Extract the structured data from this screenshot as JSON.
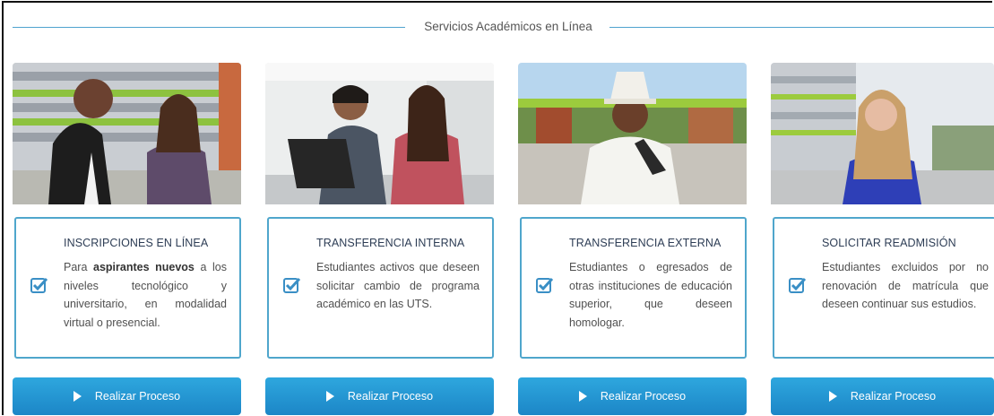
{
  "section": {
    "title": "Servicios Académicos en Línea"
  },
  "colors": {
    "accent": "#1c86c7",
    "border": "#4fa6cc",
    "heading": "#2d3d55"
  },
  "cards": [
    {
      "heading": "INSCRIPCIONES EN LÍNEA",
      "desc_pre": "Para ",
      "desc_bold": "aspirantes nuevos",
      "desc_post": " a los niveles tecnológico y universitario, en modalidad virtual o presencial.",
      "button": "Realizar Proceso",
      "icon": "checkbox-checked-icon"
    },
    {
      "heading": "TRANSFERENCIA INTERNA",
      "desc_pre": "Estudiantes activos que deseen solicitar cambio de programa académico en las UTS.",
      "desc_bold": "",
      "desc_post": "",
      "button": "Realizar Proceso",
      "icon": "checkbox-checked-icon"
    },
    {
      "heading": "TRANSFERENCIA EXTERNA",
      "desc_pre": "Estudiantes o egresados de otras instituciones de educación superior, que deseen homologar.",
      "desc_bold": "",
      "desc_post": "",
      "button": "Realizar Proceso",
      "icon": "checkbox-checked-icon"
    },
    {
      "heading": "SOLICITAR READMISIÓN",
      "desc_pre": "Estudiantes excluidos por no renovación de matrícula que deseen continuar sus estudios.",
      "desc_bold": "",
      "desc_post": "",
      "button": "Realizar Proceso",
      "icon": "checkbox-checked-icon"
    }
  ]
}
